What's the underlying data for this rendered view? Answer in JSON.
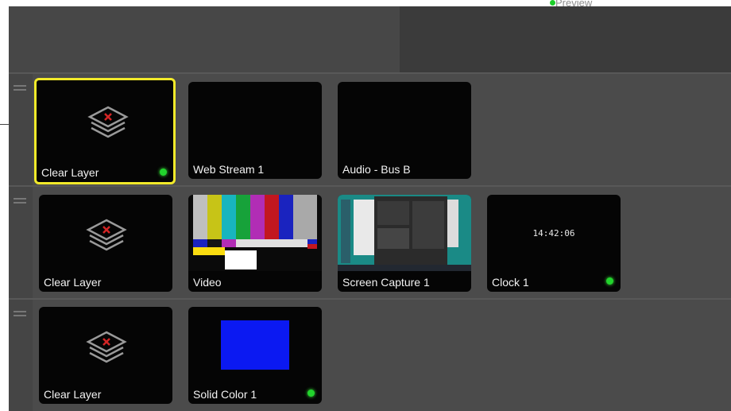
{
  "header": {
    "preview_label": "Preview"
  },
  "colors": {
    "selected_border": "#f2ea2a",
    "live_indicator": "#22d42d",
    "solid_color": "#0b19f2"
  },
  "rows": [
    {
      "tiles": [
        {
          "label": "Clear Layer",
          "icon": "layers-icon",
          "selected": true,
          "live": true
        },
        {
          "label": "Web Stream 1"
        },
        {
          "label": "Audio - Bus B"
        }
      ]
    },
    {
      "tiles": [
        {
          "label": "Clear Layer",
          "icon": "layers-icon"
        },
        {
          "label": "Video",
          "thumbnail": "color-bars"
        },
        {
          "label": "Screen Capture 1",
          "thumbnail": "desktop-screenshot"
        },
        {
          "label": "Clock 1",
          "clock": "14:42:06",
          "live": true
        }
      ]
    },
    {
      "tiles": [
        {
          "label": "Clear Layer",
          "icon": "layers-icon"
        },
        {
          "label": "Solid Color 1",
          "swatch": "#0b19f2",
          "live": true
        }
      ]
    }
  ]
}
